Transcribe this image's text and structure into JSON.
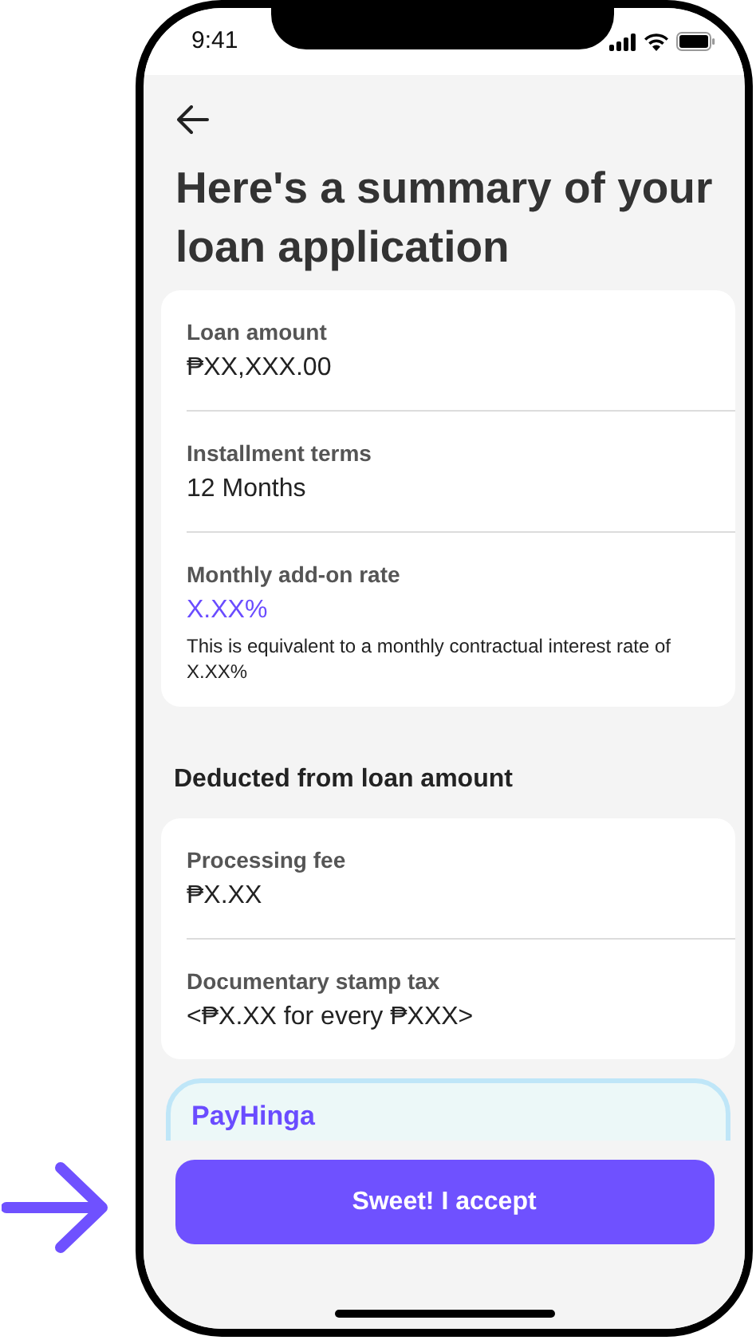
{
  "status_bar": {
    "time": "9:41"
  },
  "title": "Here's a summary of your loan application",
  "summary": [
    {
      "label": "Loan amount",
      "value": "₱XX,XXX.00",
      "highlight": false
    },
    {
      "label": "Installment terms",
      "value": "12 Months",
      "highlight": false
    },
    {
      "label": "Monthly add-on rate",
      "value": "X.XX%",
      "highlight": true,
      "note": "This is equivalent to a monthly contractual interest rate of X.XX%"
    }
  ],
  "deductions": {
    "heading": "Deducted from loan amount",
    "items": [
      {
        "label": "Processing fee",
        "value": "₱X.XX",
        "highlight": false
      },
      {
        "label": "Documentary stamp tax",
        "value": "<₱X.XX for every ₱XXX>",
        "highlight": false
      }
    ]
  },
  "promo": {
    "title": "PayHinga"
  },
  "button": {
    "label": "Sweet! I accept"
  }
}
